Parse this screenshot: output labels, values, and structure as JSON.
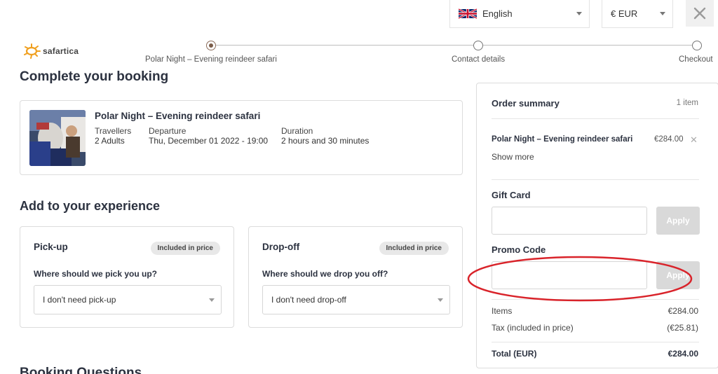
{
  "header": {
    "language": "English",
    "currency": "€ EUR",
    "brand": "safartica"
  },
  "progress": {
    "steps": [
      {
        "label": "Polar Night – Evening reindeer safari",
        "active": true
      },
      {
        "label": "Contact details",
        "active": false
      },
      {
        "label": "Checkout",
        "active": false
      }
    ]
  },
  "main": {
    "title": "Complete your booking",
    "booking": {
      "name": "Polar Night – Evening reindeer safari",
      "travellers_label": "Travellers",
      "travellers_value": "2 Adults",
      "departure_label": "Departure",
      "departure_value": "Thu, December 01 2022 - 19:00",
      "duration_label": "Duration",
      "duration_value": "2 hours and 30 minutes"
    },
    "extras_title": "Add to your experience",
    "pickup": {
      "title": "Pick-up",
      "badge": "Included in price",
      "question": "Where should we pick you up?",
      "selected": "I don't need pick-up"
    },
    "dropoff": {
      "title": "Drop-off",
      "badge": "Included in price",
      "question": "Where should we drop you off?",
      "selected": "I don't need drop-off"
    },
    "next_section": "Booking Questions"
  },
  "summary": {
    "title": "Order summary",
    "count": "1 item",
    "item_name": "Polar Night – Evening reindeer safari",
    "item_price": "€284.00",
    "show_more": "Show more",
    "gift_label": "Gift Card",
    "gift_apply": "Apply",
    "promo_label": "Promo Code",
    "promo_apply": "Apply",
    "items_label": "Items",
    "items_value": "€284.00",
    "tax_label": "Tax (included in price)",
    "tax_value": "(€25.81)",
    "total_label": "Total (EUR)",
    "total_value": "€284.00"
  },
  "colors": {
    "accent": "#7a5c49",
    "logo_orange": "#f0a020",
    "annotation": "#d9232a"
  }
}
